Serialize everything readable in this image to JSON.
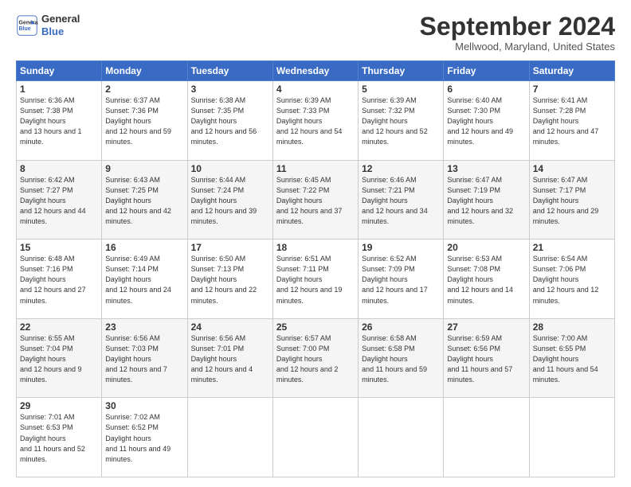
{
  "logo": {
    "line1": "General",
    "line2": "Blue"
  },
  "title": "September 2024",
  "location": "Mellwood, Maryland, United States",
  "days_of_week": [
    "Sunday",
    "Monday",
    "Tuesday",
    "Wednesday",
    "Thursday",
    "Friday",
    "Saturday"
  ],
  "weeks": [
    [
      {
        "day": "1",
        "sunrise": "6:36 AM",
        "sunset": "7:38 PM",
        "daylight": "13 hours and 1 minute."
      },
      {
        "day": "2",
        "sunrise": "6:37 AM",
        "sunset": "7:36 PM",
        "daylight": "12 hours and 59 minutes."
      },
      {
        "day": "3",
        "sunrise": "6:38 AM",
        "sunset": "7:35 PM",
        "daylight": "12 hours and 56 minutes."
      },
      {
        "day": "4",
        "sunrise": "6:39 AM",
        "sunset": "7:33 PM",
        "daylight": "12 hours and 54 minutes."
      },
      {
        "day": "5",
        "sunrise": "6:39 AM",
        "sunset": "7:32 PM",
        "daylight": "12 hours and 52 minutes."
      },
      {
        "day": "6",
        "sunrise": "6:40 AM",
        "sunset": "7:30 PM",
        "daylight": "12 hours and 49 minutes."
      },
      {
        "day": "7",
        "sunrise": "6:41 AM",
        "sunset": "7:28 PM",
        "daylight": "12 hours and 47 minutes."
      }
    ],
    [
      {
        "day": "8",
        "sunrise": "6:42 AM",
        "sunset": "7:27 PM",
        "daylight": "12 hours and 44 minutes."
      },
      {
        "day": "9",
        "sunrise": "6:43 AM",
        "sunset": "7:25 PM",
        "daylight": "12 hours and 42 minutes."
      },
      {
        "day": "10",
        "sunrise": "6:44 AM",
        "sunset": "7:24 PM",
        "daylight": "12 hours and 39 minutes."
      },
      {
        "day": "11",
        "sunrise": "6:45 AM",
        "sunset": "7:22 PM",
        "daylight": "12 hours and 37 minutes."
      },
      {
        "day": "12",
        "sunrise": "6:46 AM",
        "sunset": "7:21 PM",
        "daylight": "12 hours and 34 minutes."
      },
      {
        "day": "13",
        "sunrise": "6:47 AM",
        "sunset": "7:19 PM",
        "daylight": "12 hours and 32 minutes."
      },
      {
        "day": "14",
        "sunrise": "6:47 AM",
        "sunset": "7:17 PM",
        "daylight": "12 hours and 29 minutes."
      }
    ],
    [
      {
        "day": "15",
        "sunrise": "6:48 AM",
        "sunset": "7:16 PM",
        "daylight": "12 hours and 27 minutes."
      },
      {
        "day": "16",
        "sunrise": "6:49 AM",
        "sunset": "7:14 PM",
        "daylight": "12 hours and 24 minutes."
      },
      {
        "day": "17",
        "sunrise": "6:50 AM",
        "sunset": "7:13 PM",
        "daylight": "12 hours and 22 minutes."
      },
      {
        "day": "18",
        "sunrise": "6:51 AM",
        "sunset": "7:11 PM",
        "daylight": "12 hours and 19 minutes."
      },
      {
        "day": "19",
        "sunrise": "6:52 AM",
        "sunset": "7:09 PM",
        "daylight": "12 hours and 17 minutes."
      },
      {
        "day": "20",
        "sunrise": "6:53 AM",
        "sunset": "7:08 PM",
        "daylight": "12 hours and 14 minutes."
      },
      {
        "day": "21",
        "sunrise": "6:54 AM",
        "sunset": "7:06 PM",
        "daylight": "12 hours and 12 minutes."
      }
    ],
    [
      {
        "day": "22",
        "sunrise": "6:55 AM",
        "sunset": "7:04 PM",
        "daylight": "12 hours and 9 minutes."
      },
      {
        "day": "23",
        "sunrise": "6:56 AM",
        "sunset": "7:03 PM",
        "daylight": "12 hours and 7 minutes."
      },
      {
        "day": "24",
        "sunrise": "6:56 AM",
        "sunset": "7:01 PM",
        "daylight": "12 hours and 4 minutes."
      },
      {
        "day": "25",
        "sunrise": "6:57 AM",
        "sunset": "7:00 PM",
        "daylight": "12 hours and 2 minutes."
      },
      {
        "day": "26",
        "sunrise": "6:58 AM",
        "sunset": "6:58 PM",
        "daylight": "11 hours and 59 minutes."
      },
      {
        "day": "27",
        "sunrise": "6:59 AM",
        "sunset": "6:56 PM",
        "daylight": "11 hours and 57 minutes."
      },
      {
        "day": "28",
        "sunrise": "7:00 AM",
        "sunset": "6:55 PM",
        "daylight": "11 hours and 54 minutes."
      }
    ],
    [
      {
        "day": "29",
        "sunrise": "7:01 AM",
        "sunset": "6:53 PM",
        "daylight": "11 hours and 52 minutes."
      },
      {
        "day": "30",
        "sunrise": "7:02 AM",
        "sunset": "6:52 PM",
        "daylight": "11 hours and 49 minutes."
      },
      null,
      null,
      null,
      null,
      null
    ]
  ]
}
